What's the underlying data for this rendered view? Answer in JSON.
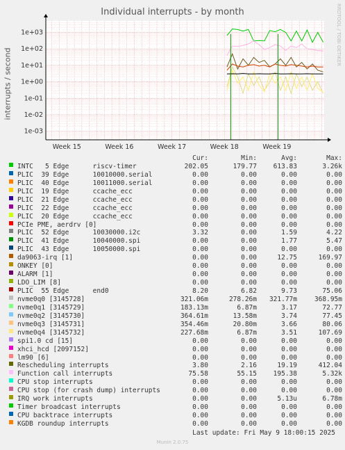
{
  "title": "Individual interrupts - by month",
  "watermark": "RRDTOOL / TOBI OETIKER",
  "ylabel": "interrupts / second",
  "chart_data": {
    "type": "line",
    "title": "Individual interrupts - by month",
    "ylabel": "interrupts / second",
    "yscale": "log",
    "ylim": [
      0.0003,
      5000
    ],
    "yticks": [
      {
        "label": "1e+03",
        "value": 1000
      },
      {
        "label": "1e+02",
        "value": 100
      },
      {
        "label": "1e+01",
        "value": 10
      },
      {
        "label": "1e+00",
        "value": 1
      },
      {
        "label": "1e-01",
        "value": 0.1
      },
      {
        "label": "1e-02",
        "value": 0.01
      },
      {
        "label": "1e-03",
        "value": 0.001
      }
    ],
    "xticks": [
      "Week 15",
      "Week 16",
      "Week 17",
      "Week 18",
      "Week 19"
    ],
    "x_range_weeks": [
      14.6,
      19.9
    ],
    "grid": true,
    "series": [
      {
        "name": "INTC 5 Edge riscv-timer",
        "color": "#00cc00",
        "start": 18.05,
        "values": [
          650,
          1600,
          1500,
          1200,
          1500,
          300,
          320,
          300,
          1300,
          1100,
          1500,
          1000,
          300,
          1200,
          300,
          1400,
          250,
          1000,
          250
        ]
      },
      {
        "name": "Function call interrupts",
        "color": "#ffb3e6",
        "start": 18.05,
        "values": [
          40,
          150,
          140,
          160,
          200,
          300,
          180,
          90,
          120,
          180,
          150,
          80,
          150,
          120,
          200,
          100,
          90,
          80,
          75
        ]
      },
      {
        "name": "Rescheduling interrupts",
        "color": "#6b5a1a",
        "start": 18.05,
        "values": [
          8,
          50,
          6,
          25,
          10,
          30,
          15,
          20,
          8,
          12,
          25,
          10,
          30,
          8,
          15,
          6,
          12,
          5,
          4
        ]
      },
      {
        "name": "da9063-irq [1]",
        "color": "#cc4400",
        "start": 18.05,
        "values": [
          5,
          12,
          9,
          8,
          10,
          11,
          9,
          10,
          8,
          12,
          10,
          9,
          11,
          10,
          9,
          8,
          9,
          8,
          8
        ]
      },
      {
        "name": "nvme0q1 [3145729]",
        "color": "#dddd88",
        "start": 18.05,
        "values": [
          0.5,
          8,
          2,
          0.2,
          3,
          0.6,
          2,
          0.3,
          1,
          4,
          0.3,
          2,
          0.2,
          3,
          0.5,
          2,
          0.3,
          1,
          0.2
        ]
      },
      {
        "name": "nvme0q4 [3145732]",
        "color": "#ffee77",
        "start": 18.05,
        "values": [
          0.3,
          5,
          0.8,
          2,
          0.3,
          4,
          0.6,
          0.25,
          3,
          0.8,
          2,
          0.3,
          4,
          0.4,
          2,
          0.3,
          3,
          0.4,
          0.23
        ]
      },
      {
        "name": "PLIC 55 Edge end0",
        "color": "#000000",
        "start": 18.05,
        "values": [
          3,
          3.1,
          3,
          3.2,
          3,
          3,
          3.1,
          3,
          3,
          3.2,
          3,
          3,
          3.1,
          3,
          3,
          3.1,
          3,
          3,
          3
        ]
      }
    ]
  },
  "legend": {
    "headers": {
      "cur": "Cur:",
      "min": "Min:",
      "avg": "Avg:",
      "max": "Max:"
    },
    "rows": [
      {
        "name": "INTC   5 Edge      riscv-timer",
        "color": "#00cc00",
        "cur": "202.05",
        "min": "179.77",
        "avg": "613.83",
        "max": "3.26k"
      },
      {
        "name": "PLIC  39 Edge      10010000.serial",
        "color": "#0066b3",
        "cur": "0.00",
        "min": "0.00",
        "avg": "0.00",
        "max": "0.00"
      },
      {
        "name": "PLIC  40 Edge      10011000.serial",
        "color": "#ff8000",
        "cur": "0.00",
        "min": "0.00",
        "avg": "0.00",
        "max": "0.00"
      },
      {
        "name": "PLIC  19 Edge      ccache_ecc",
        "color": "#ffcc00",
        "cur": "0.00",
        "min": "0.00",
        "avg": "0.00",
        "max": "0.00"
      },
      {
        "name": "PLIC  21 Edge      ccache_ecc",
        "color": "#330099",
        "cur": "0.00",
        "min": "0.00",
        "avg": "0.00",
        "max": "0.00"
      },
      {
        "name": "PLIC  22 Edge      ccache_ecc",
        "color": "#990099",
        "cur": "0.00",
        "min": "0.00",
        "avg": "0.00",
        "max": "0.00"
      },
      {
        "name": "PLIC  20 Edge      ccache_ecc",
        "color": "#ccff00",
        "cur": "0.00",
        "min": "0.00",
        "avg": "0.00",
        "max": "0.00"
      },
      {
        "name": "PCIe PME, aerdrv [0]",
        "color": "#ff0000",
        "cur": "0.00",
        "min": "0.00",
        "avg": "0.00",
        "max": "0.00"
      },
      {
        "name": "PLIC  52 Edge      10030000.i2c",
        "color": "#808080",
        "cur": "3.32",
        "min": "0.00",
        "avg": "1.59",
        "max": "4.22"
      },
      {
        "name": "PLIC  41 Edge      10040000.spi",
        "color": "#008f00",
        "cur": "0.00",
        "min": "0.00",
        "avg": "1.77",
        "max": "5.47"
      },
      {
        "name": "PLIC  43 Edge      10050000.spi",
        "color": "#00487d",
        "cur": "0.00",
        "min": "0.00",
        "avg": "0.00",
        "max": "0.00"
      },
      {
        "name": "da9063-irq [1]",
        "color": "#b35a00",
        "cur": "0.00",
        "min": "0.00",
        "avg": "12.75",
        "max": "169.97"
      },
      {
        "name": "ONKEY [0]",
        "color": "#b38f00",
        "cur": "0.00",
        "min": "0.00",
        "avg": "0.00",
        "max": "0.00"
      },
      {
        "name": "ALARM [1]",
        "color": "#6b006b",
        "cur": "0.00",
        "min": "0.00",
        "avg": "0.00",
        "max": "0.00"
      },
      {
        "name": "LDO_LIM [8]",
        "color": "#8fb300",
        "cur": "0.00",
        "min": "0.00",
        "avg": "0.00",
        "max": "0.00"
      },
      {
        "name": "PLIC  55 Edge      end0",
        "color": "#b30000",
        "cur": "8.20",
        "min": "6.82",
        "avg": "9.73",
        "max": "75.06"
      },
      {
        "name": "nvme0q0 [3145728]",
        "color": "#bebebe",
        "cur": "321.06m",
        "min": "278.26m",
        "avg": "321.77m",
        "max": "368.95m"
      },
      {
        "name": "nvme0q1 [3145729]",
        "color": "#80ff80",
        "cur": "183.13m",
        "min": "6.87m",
        "avg": "3.17",
        "max": "72.77"
      },
      {
        "name": "nvme0q2 [3145730]",
        "color": "#80c9ff",
        "cur": "364.61m",
        "min": "13.58m",
        "avg": "3.74",
        "max": "77.45"
      },
      {
        "name": "nvme0q3 [3145731]",
        "color": "#ffc080",
        "cur": "354.46m",
        "min": "20.80m",
        "avg": "3.66",
        "max": "80.06"
      },
      {
        "name": "nvme0q4 [3145732]",
        "color": "#ffe680",
        "cur": "227.68m",
        "min": "6.87m",
        "avg": "3.51",
        "max": "107.69"
      },
      {
        "name": "spi1.0 cd [15]",
        "color": "#aa80ff",
        "cur": "0.00",
        "min": "0.00",
        "avg": "0.00",
        "max": "0.00"
      },
      {
        "name": "xhci_hcd [2097152]",
        "color": "#ee00cc",
        "cur": "0.00",
        "min": "0.00",
        "avg": "0.00",
        "max": "0.00"
      },
      {
        "name": "lm90 [6]",
        "color": "#ff8080",
        "cur": "0.00",
        "min": "0.00",
        "avg": "0.00",
        "max": "0.00"
      },
      {
        "name": "Rescheduling interrupts",
        "color": "#666600",
        "cur": "3.80",
        "min": "2.16",
        "avg": "19.19",
        "max": "412.04"
      },
      {
        "name": "Function call interrupts",
        "color": "#ffbfff",
        "cur": "75.58",
        "min": "55.15",
        "avg": "195.38",
        "max": "5.32k"
      },
      {
        "name": "CPU stop interrupts",
        "color": "#00ffcc",
        "cur": "0.00",
        "min": "0.00",
        "avg": "0.00",
        "max": "0.00"
      },
      {
        "name": "CPU stop (for crash dump) interrupts",
        "color": "#cc6699",
        "cur": "0.00",
        "min": "0.00",
        "avg": "0.00",
        "max": "0.00"
      },
      {
        "name": "IRQ work interrupts",
        "color": "#999900",
        "cur": "0.00",
        "min": "0.00",
        "avg": "5.13u",
        "max": "6.78m"
      },
      {
        "name": "Timer broadcast interrupts",
        "color": "#00cc00",
        "cur": "0.00",
        "min": "0.00",
        "avg": "0.00",
        "max": "0.00"
      },
      {
        "name": "CPU backtrace interrupts",
        "color": "#0066b3",
        "cur": "0.00",
        "min": "0.00",
        "avg": "0.00",
        "max": "0.00"
      },
      {
        "name": "KGDB roundup interrupts",
        "color": "#ff8000",
        "cur": "0.00",
        "min": "0.00",
        "avg": "0.00",
        "max": "0.00"
      }
    ]
  },
  "last_update": "Last update: Fri May  9 18:00:15 2025",
  "munin_version": "Munin 2.0.75"
}
